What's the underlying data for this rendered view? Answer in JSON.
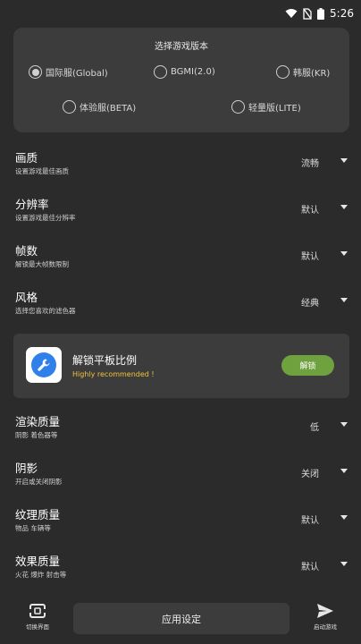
{
  "status": {
    "time": "5:26"
  },
  "version": {
    "title": "选择游戏版本",
    "options": [
      {
        "label": "国际服(Global)",
        "checked": true
      },
      {
        "label": "BGMI(2.0)",
        "checked": false
      },
      {
        "label": "韩服(KR)",
        "checked": false
      },
      {
        "label": "体验服(BETA)",
        "checked": false
      },
      {
        "label": "轻量版(LITE)",
        "checked": false
      }
    ]
  },
  "settings": [
    {
      "title": "画质",
      "subtitle": "设置游戏最佳画质",
      "value": "流畅"
    },
    {
      "title": "分辨率",
      "subtitle": "设置游戏最佳分辨率",
      "value": "默认"
    },
    {
      "title": "帧数",
      "subtitle": "解锁最大帧数限制",
      "value": "默认"
    },
    {
      "title": "风格",
      "subtitle": "选择您喜欢的滤色器",
      "value": "经典"
    },
    {
      "title": "渲染质量",
      "subtitle": "阴影 着色器等",
      "value": "低"
    },
    {
      "title": "阴影",
      "subtitle": "开启或关闭阴影",
      "value": "关闭"
    },
    {
      "title": "纹理质量",
      "subtitle": "物品 车辆等",
      "value": "默认"
    },
    {
      "title": "效果质量",
      "subtitle": "火花 爆炸 射击等",
      "value": "默认"
    }
  ],
  "unlock": {
    "title": "解锁平板比例",
    "subtitle": "Highly recommended !",
    "button": "解锁",
    "accent": "#70a13f",
    "icon": "wrench-icon"
  },
  "bottom": {
    "left_label": "切换界面",
    "apply_label": "应用设定",
    "right_label": "启动游戏",
    "left_icon": "switch-screen-icon",
    "right_icon": "send-icon"
  }
}
